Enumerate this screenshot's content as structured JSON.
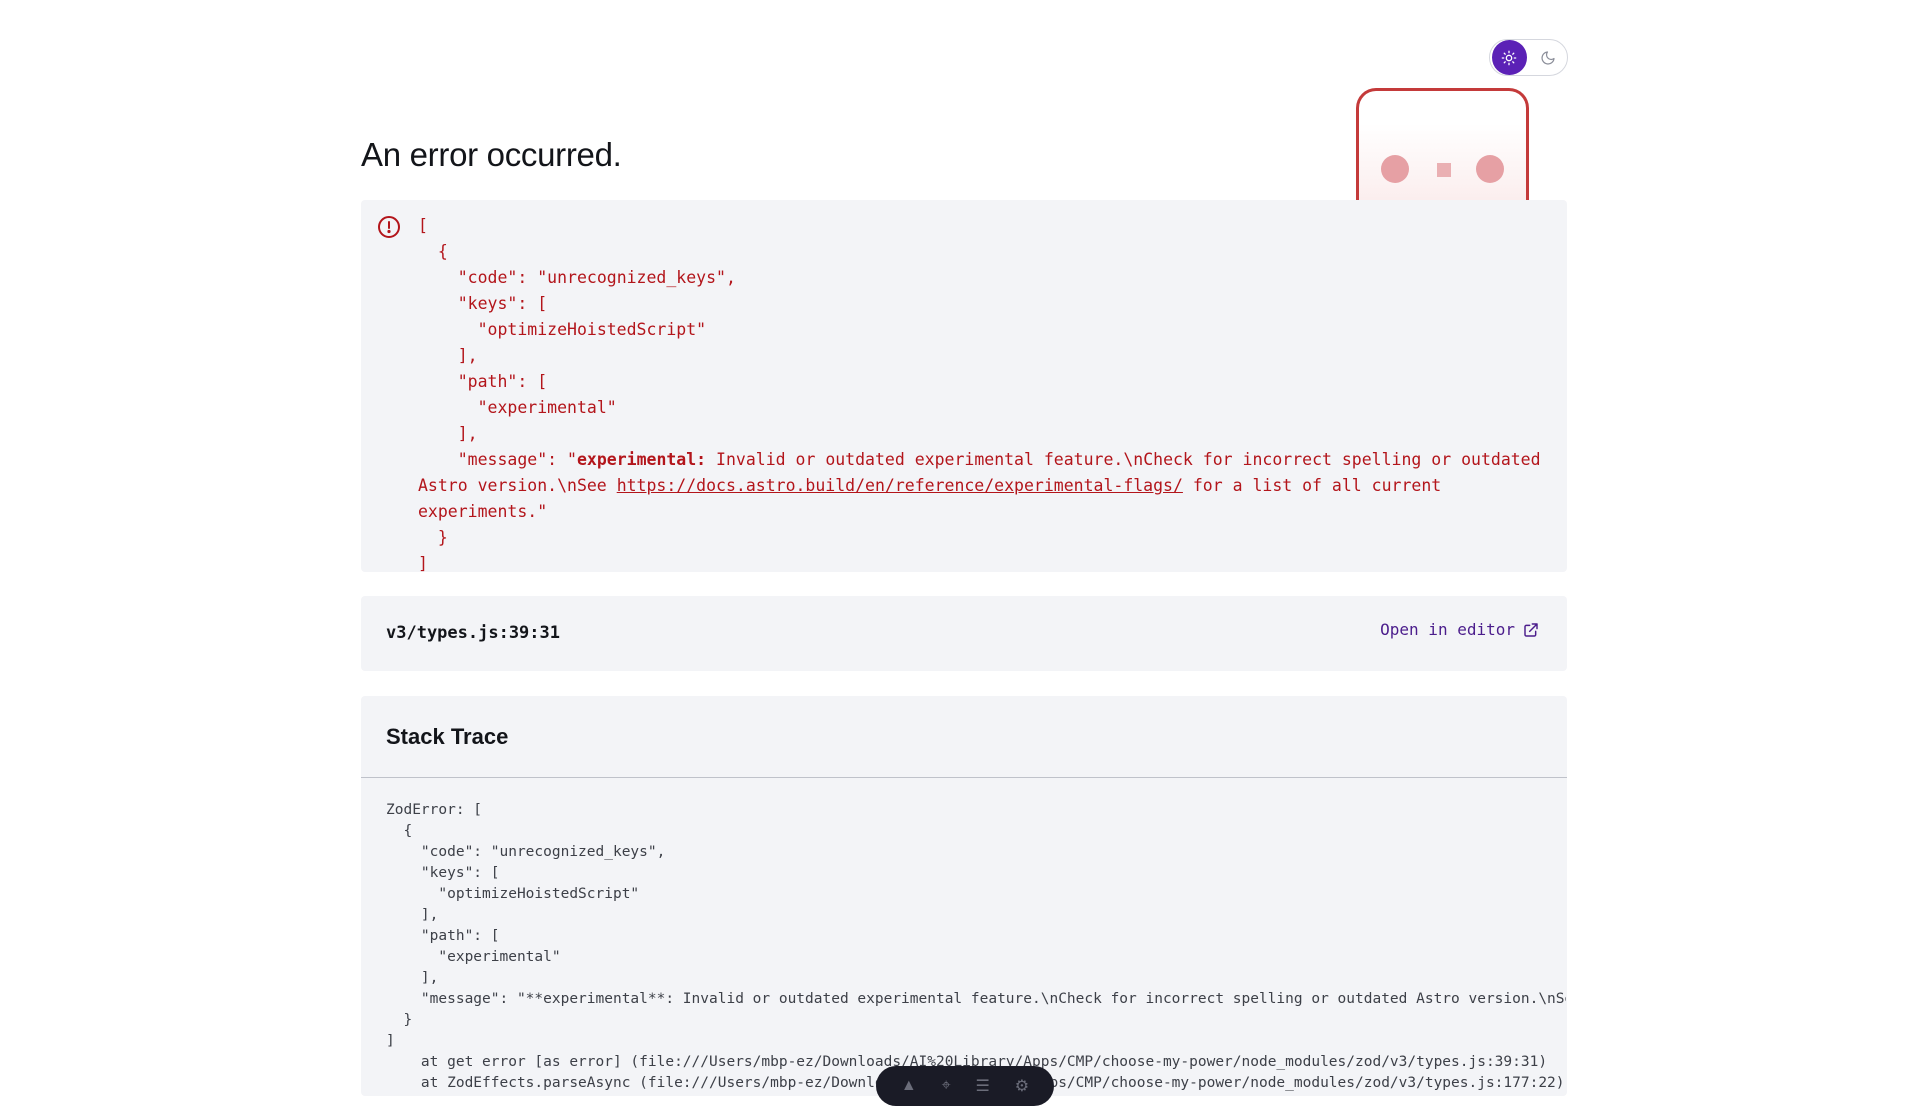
{
  "theme_toggle": {
    "light_icon": "sun-icon",
    "dark_icon": "moon-icon",
    "active": "light"
  },
  "page_title": "An error occurred.",
  "error_message": {
    "prefix": "[\n  {\n    \"code\": \"unrecognized_keys\",\n    \"keys\": [\n      \"optimizeHoistedScript\"\n    ],\n    \"path\": [\n      \"experimental\"\n    ],\n    \"message\": \"",
    "bold": "experimental:",
    "middle": " Invalid or outdated experimental feature.\\nCheck for incorrect spelling or outdated Astro version.\\nSee ",
    "link": "https://docs.astro.build/en/reference/experimental-flags/",
    "suffix": " for a list of all current experiments.\"\n  }\n]"
  },
  "location": {
    "path": "v3/types.js:39:31",
    "open_label": "Open in editor"
  },
  "stack_trace": {
    "heading": "Stack Trace",
    "text": "ZodError: [\n  {\n    \"code\": \"unrecognized_keys\",\n    \"keys\": [\n      \"optimizeHoistedScript\"\n    ],\n    \"path\": [\n      \"experimental\"\n    ],\n    \"message\": \"**experimental**: Invalid or outdated experimental feature.\\nCheck for incorrect spelling or outdated Astro version.\\nSee https://docs.astro.build/en/reference/experimental-flags/ for a list of all current experiments.\"\n  }\n]\n    at get error [as error] (file:///Users/mbp-ez/Downloads/AI%20Library/Apps/CMP/choose-my-power/node_modules/zod/v3/types.js:39:31)\n    at ZodEffects.parseAsync (file:///Users/mbp-ez/Downloads/AI%20Library/Apps/CMP/choose-my-power/node_modules/zod/v3/types.js:177:22)"
  },
  "dev_toolbar": {
    "icons": [
      "astro-logo-icon",
      "inspect-icon",
      "menu-icon",
      "settings-icon"
    ]
  }
}
